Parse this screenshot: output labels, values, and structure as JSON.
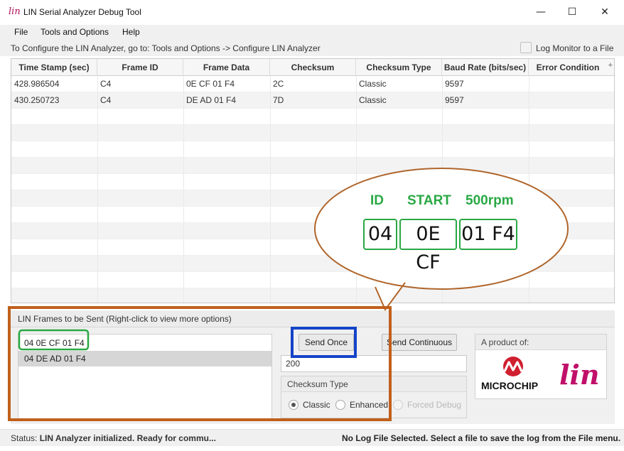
{
  "window": {
    "title": "LIN Serial Analyzer Debug Tool",
    "app_icon_glyph": "lin",
    "minimize_glyph": "—",
    "maximize_glyph": "☐",
    "close_glyph": "✕"
  },
  "menu": {
    "items": [
      "File",
      "Tools and Options",
      "Help"
    ]
  },
  "hint": {
    "text": "To Configure the LIN Analyzer, go to: Tools and Options -> Configure LIN Analyzer",
    "log_label": "Log Monitor to a File",
    "log_checked": false
  },
  "table": {
    "columns": [
      "Time Stamp (sec)",
      "Frame ID",
      "Frame Data",
      "Checksum",
      "Checksum Type",
      "Baud Rate (bits/sec)",
      "Error Condition"
    ],
    "add_column_glyph": "+",
    "rows": [
      [
        "428.986504",
        "C4",
        "0E CF 01 F4",
        "2C",
        "Classic",
        "9597",
        ""
      ],
      [
        "430.250723",
        "C4",
        "DE AD 01 F4",
        "7D",
        "Classic",
        "9597",
        ""
      ]
    ]
  },
  "frames": {
    "title": "LIN Frames to be Sent (Right-click to view more options)",
    "items": [
      "04 0E CF 01 F4",
      "04 DE AD 01 F4"
    ],
    "send_once": "Send Once",
    "send_continuous": "Send Continuous",
    "interval": "200",
    "checksum_type_title": "Checksum Type",
    "checksum_options": [
      "Classic",
      "Enhanced",
      "Forced Debug"
    ],
    "checksum_selected": "Classic",
    "product_title": "A product of:",
    "microchip_text": "MICROCHIP",
    "lin_logo": "lin"
  },
  "status": {
    "prefix": "Status:",
    "message": "LIN Analyzer initialized. Ready for commu...",
    "log_message": "No Log File Selected. Select a file to save the log from the File menu."
  },
  "callout": {
    "labels": [
      "ID",
      "START",
      "500rpm"
    ],
    "boxes": [
      "04",
      "0E CF",
      "01 F4"
    ],
    "highlight_color": "#2aa844",
    "bubble_color": "#b0652a",
    "panel_frame_color": "#c0601c",
    "send_highlight_color": "#1544c8"
  }
}
